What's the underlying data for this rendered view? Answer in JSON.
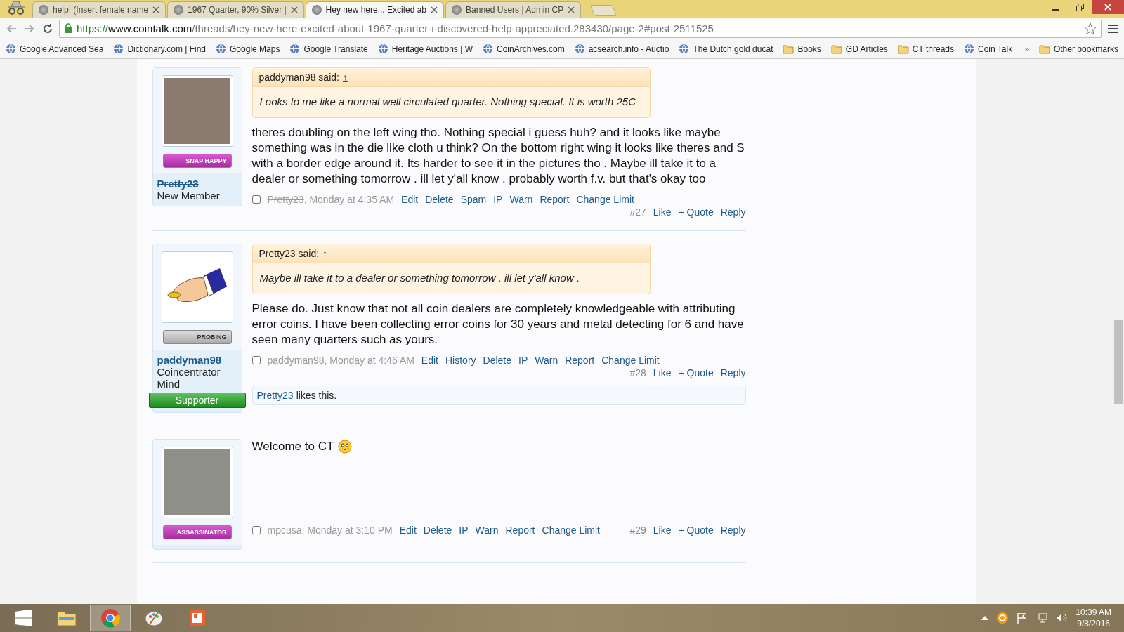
{
  "browser": {
    "tabs": [
      {
        "title": "help! (Insert female name",
        "selected": false
      },
      {
        "title": "1967 Quarter, 90% Silver |",
        "selected": false
      },
      {
        "title": "Hey new here... Excited ab",
        "selected": true
      },
      {
        "title": "Banned Users | Admin CP",
        "selected": false
      }
    ],
    "address": {
      "scheme": "https://",
      "host": "www.cointalk.com",
      "path": "/threads/hey-new-here-excited-about-1967-quarter-i-discovered-help-appreciated.283430/page-2#post-2511525"
    },
    "bookmarks": [
      {
        "kind": "site",
        "label": "Google Advanced Sea"
      },
      {
        "kind": "site",
        "label": "Dictionary.com | Find"
      },
      {
        "kind": "site",
        "label": "Google Maps"
      },
      {
        "kind": "site",
        "label": "Google Translate"
      },
      {
        "kind": "site",
        "label": "Heritage Auctions | W"
      },
      {
        "kind": "site",
        "label": "CoinArchives.com"
      },
      {
        "kind": "site",
        "label": "acsearch.info - Auctio"
      },
      {
        "kind": "site",
        "label": "The Dutch gold ducat"
      },
      {
        "kind": "folder",
        "label": "Books"
      },
      {
        "kind": "folder",
        "label": "GD Articles"
      },
      {
        "kind": "folder",
        "label": "CT threads"
      },
      {
        "kind": "site",
        "label": "Coin Talk"
      }
    ],
    "more_bookmarks": "»",
    "other_bookmarks": {
      "kind": "folder",
      "label": "Other bookmarks"
    }
  },
  "posts": [
    {
      "user": {
        "name": "Pretty23",
        "struck": true,
        "title": "New Member",
        "avatar": {
          "kind": "photo"
        },
        "badge": "SNAP HAPPY"
      },
      "quote": {
        "header": "paddyman98 said:",
        "arrow": "↑",
        "text": "Looks to me like a normal well circulated quarter. Nothing special. It is worth 25C"
      },
      "message": "theres doubling on the left wing tho. Nothing special i guess huh? and it looks like maybe something was in the die like cloth u think? On the bottom right wing it looks like theres and S with a border edge around it. Its harder to see it in the pictures tho . Maybe ill take it to a dealer or something tomorrow . ill let y'all know . probably worth f.v. but that's okay too",
      "meta": {
        "checked": false,
        "author": "Pretty23",
        "author_struck": true,
        "time": ", Monday at 4:35 AM",
        "actions": [
          "Edit",
          "Delete",
          "Spam",
          "IP",
          "Warn",
          "Report",
          "Change Limit"
        ]
      },
      "number": "#27",
      "footer_actions": [
        "Like",
        "+ Quote",
        "Reply"
      ]
    },
    {
      "user": {
        "name": "paddyman98",
        "struck": false,
        "title": "Coincentrator Mind",
        "avatar": {
          "kind": "hand"
        },
        "badge": "PROBING",
        "supporter": "Supporter"
      },
      "quote": {
        "header": "Pretty23 said:",
        "arrow": "↑",
        "text": "Maybe ill take it to a dealer or something tomorrow . ill let y'all know ."
      },
      "message": "Please do. Just know that not all coin dealers are completely knowledgeable with attributing error coins. I have been collecting error coins for 30 years and metal detecting for 6 and have seen many quarters such as yours.",
      "meta": {
        "checked": false,
        "author": "paddyman98",
        "author_struck": false,
        "time": ", Monday at 4:46 AM",
        "actions": [
          "Edit",
          "History",
          "Delete",
          "IP",
          "Warn",
          "Report",
          "Change Limit"
        ]
      },
      "number": "#28",
      "footer_actions": [
        "Like",
        "+ Quote",
        "Reply"
      ],
      "likes": {
        "user": "Pretty23",
        "text": "likes this."
      }
    },
    {
      "user": {
        "avatar": {
          "kind": "banknote"
        },
        "badge": "ASSASSINATOR"
      },
      "message": "Welcome to CT",
      "emoticon": true,
      "meta": {
        "checked": false,
        "author": "mpcusa",
        "author_struck": false,
        "time": ", Monday at 3:10 PM",
        "actions": [
          "Edit",
          "Delete",
          "IP",
          "Warn",
          "Report",
          "Change Limit"
        ]
      },
      "number": "#29",
      "footer_actions": [
        "Like",
        "+ Quote",
        "Reply"
      ]
    }
  ],
  "taskbar": {
    "apps": [
      {
        "kind": "explorer",
        "selected": false
      },
      {
        "kind": "chrome",
        "selected": true
      },
      {
        "kind": "paint",
        "selected": false
      },
      {
        "kind": "office",
        "selected": false
      }
    ],
    "time": "10:39 AM",
    "date": "9/8/2016"
  }
}
